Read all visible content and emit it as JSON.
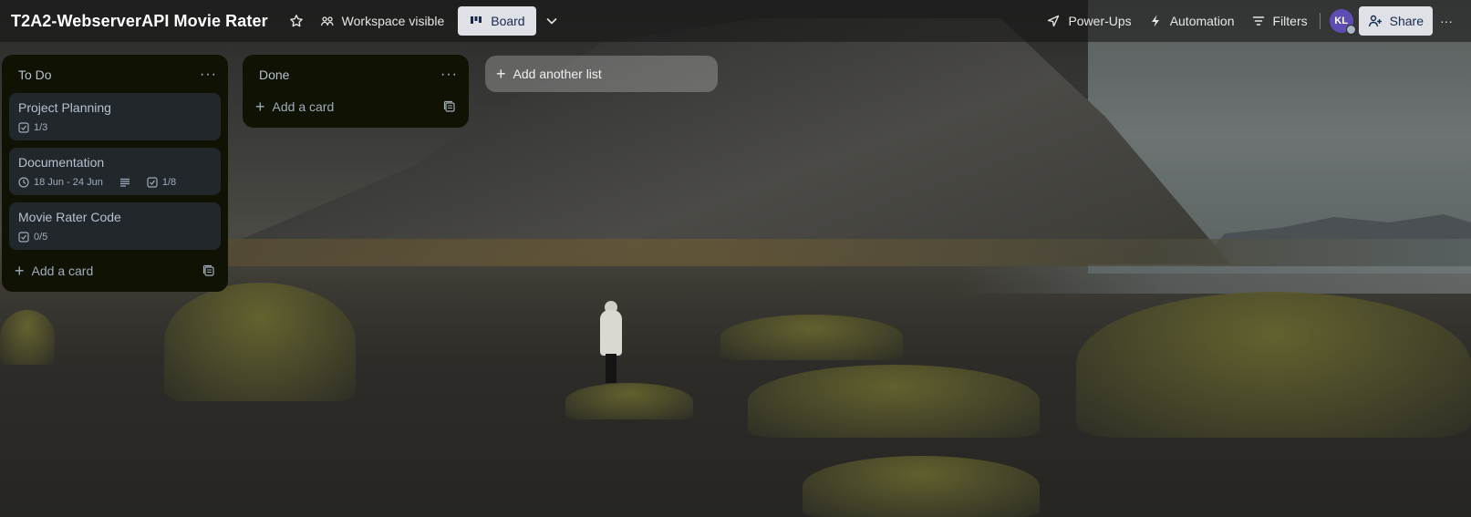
{
  "header": {
    "board_title": "T2A2-WebserverAPI Movie Rater",
    "visibility_label": "Workspace visible",
    "view_label": "Board",
    "powerups_label": "Power-Ups",
    "automation_label": "Automation",
    "filters_label": "Filters",
    "avatar_initials": "KL",
    "share_label": "Share",
    "more_label": "···"
  },
  "lists": [
    {
      "title": "To Do",
      "menu": "···",
      "cards": [
        {
          "title": "Project Planning",
          "checklist": "1/3"
        },
        {
          "title": "Documentation",
          "dates": "18 Jun - 24 Jun",
          "checklist": "1/8"
        },
        {
          "title": "Movie Rater Code",
          "checklist": "0/5"
        }
      ],
      "add_card_label": "Add a card"
    },
    {
      "title": "Done",
      "menu": "···",
      "cards": [],
      "add_card_label": "Add a card"
    }
  ],
  "add_list_label": "Add another list",
  "colors": {
    "list_bg": "#101204",
    "card_bg": "#22272b",
    "avatar": "#5e4db2",
    "button_light": "#dfe1e6"
  },
  "icons": [
    "star-icon",
    "workspace-icon",
    "board-icon",
    "chevron-down-icon",
    "rocket-icon",
    "lightning-icon",
    "filter-icon",
    "add-person-icon",
    "checklist-icon",
    "clock-icon",
    "description-icon",
    "template-icon"
  ]
}
